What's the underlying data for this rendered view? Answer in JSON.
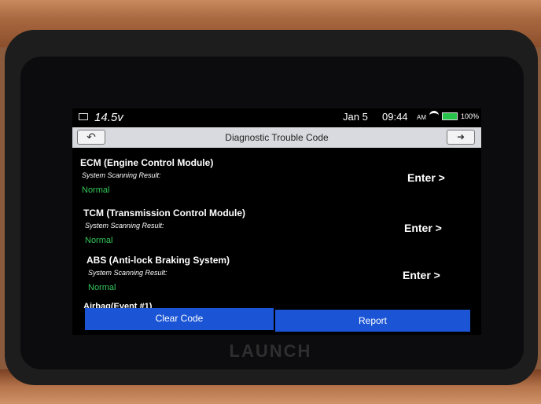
{
  "status_bar": {
    "voltage": "14.5v",
    "date": "Jan 5",
    "time": "09:44",
    "ampm": "AM",
    "battery_percent": "100%",
    "battery_level": 1.0
  },
  "header": {
    "title": "Diagnostic Trouble Code",
    "back_icon": "back-arrow-icon",
    "exit_icon": "exit-icon"
  },
  "modules": [
    {
      "name": "ECM (Engine Control Module)",
      "scan_label": "System Scanning Result:",
      "result": "Normal",
      "action": "Enter >"
    },
    {
      "name": "TCM (Transmission Control Module)",
      "scan_label": "System Scanning Result:",
      "result": "Normal",
      "action": "Enter >"
    },
    {
      "name": "ABS (Anti-lock Braking System)",
      "scan_label": "System Scanning Result:",
      "result": "Normal",
      "action": "Enter >"
    }
  ],
  "partial_item": "Airbag(Event #1)",
  "footer": {
    "clear_label": "Clear Code",
    "report_label": "Report"
  },
  "device": {
    "brand": "LAUNCH"
  },
  "colors": {
    "accent": "#1b55d6",
    "normal": "#34c759",
    "header_bg": "#d9dadf"
  }
}
